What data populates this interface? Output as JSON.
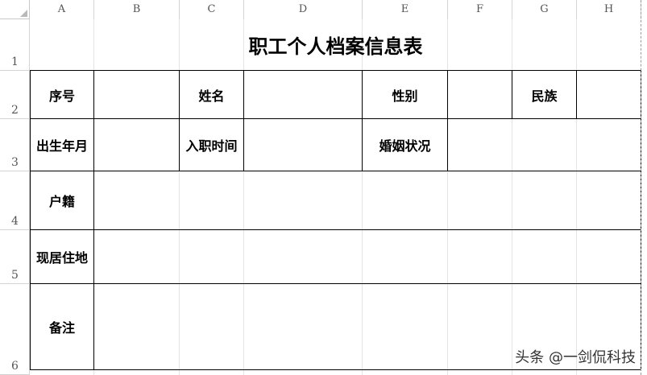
{
  "columns": [
    "A",
    "B",
    "C",
    "D",
    "E",
    "F",
    "G",
    "H"
  ],
  "rows": [
    "1",
    "2",
    "3",
    "4",
    "5",
    "6"
  ],
  "sheet": {
    "title": "职工个人档案信息表",
    "labels": {
      "seq": "序号",
      "name": "姓名",
      "gender": "性别",
      "ethnicity": "民族",
      "birth": "出生年月",
      "hire": "入职时间",
      "marriage": "婚姻状况",
      "household": "户籍",
      "residence": "现居住地",
      "remarks": "备注"
    }
  },
  "watermark": "头条 @一剑侃科技"
}
